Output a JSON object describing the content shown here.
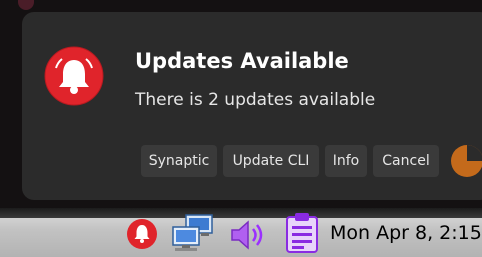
{
  "notification": {
    "title": "Updates Available",
    "message": "There is 2 updates available",
    "icon": "alert-bell-icon",
    "actions": [
      "Synaptic",
      "Update CLI",
      "Info",
      "Cancel"
    ]
  },
  "taskbar": {
    "tray_icons": [
      "alert-bell-icon",
      "network-icon",
      "volume-icon",
      "clipboard-icon"
    ],
    "clock": "Mon Apr  8,  2:15"
  },
  "colors": {
    "alert_red": "#e0242b",
    "popup_bg": "#2b2b2b",
    "button_bg": "#3a3a3a",
    "accent_purple": "#9b30ff",
    "accent_orange": "#c46a1b"
  }
}
